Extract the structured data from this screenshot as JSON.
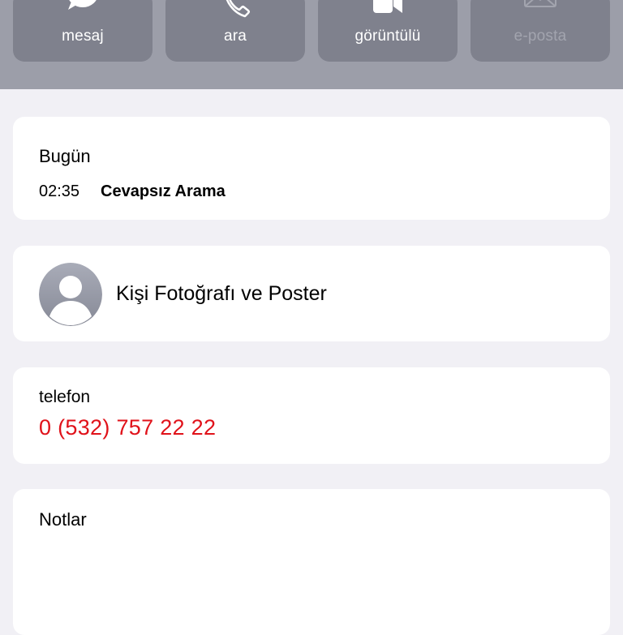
{
  "actions": [
    {
      "label": "mesaj",
      "icon": "message-bubble-icon",
      "enabled": true
    },
    {
      "label": "ara",
      "icon": "phone-icon",
      "enabled": true
    },
    {
      "label": "görüntülü",
      "icon": "video-camera-icon",
      "enabled": true
    },
    {
      "label": "e-posta",
      "icon": "envelope-icon",
      "enabled": false
    }
  ],
  "recents": {
    "title": "Bugün",
    "time": "02:35",
    "type": "Cevapsız Arama"
  },
  "photo": {
    "label": "Kişi Fotoğrafı ve Poster",
    "icon": "person-avatar-icon"
  },
  "phone": {
    "label": "telefon",
    "number": "0 (532) 757 22 22"
  },
  "notes": {
    "label": "Notlar"
  },
  "colors": {
    "header_bg": "#9c9ea9",
    "button_bg": "#7f818d",
    "phone_number": "#e0121a",
    "page_bg": "#f1f0f5"
  }
}
